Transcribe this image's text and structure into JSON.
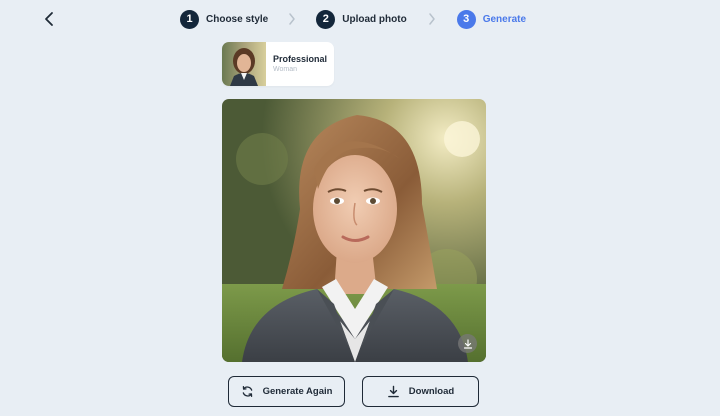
{
  "nav": {
    "back_icon": "chevron-left-icon"
  },
  "stepper": {
    "steps": [
      {
        "number": "1",
        "label": "Choose style",
        "state": "done"
      },
      {
        "number": "2",
        "label": "Upload photo",
        "state": "done"
      },
      {
        "number": "3",
        "label": "Generate",
        "state": "active"
      }
    ],
    "separator_icon": "chevron-right-icon"
  },
  "style_chip": {
    "title": "Professional",
    "subtitle": "Woman"
  },
  "result": {
    "image_subject": "portrait of a woman in a gray blazer outdoors",
    "download_icon": "download-icon"
  },
  "actions": {
    "generate_again": "Generate Again",
    "download": "Download"
  },
  "colors": {
    "background": "#e8eef4",
    "step_done": "#13263a",
    "step_active": "#4a79ea",
    "text": "#1f2a37"
  }
}
